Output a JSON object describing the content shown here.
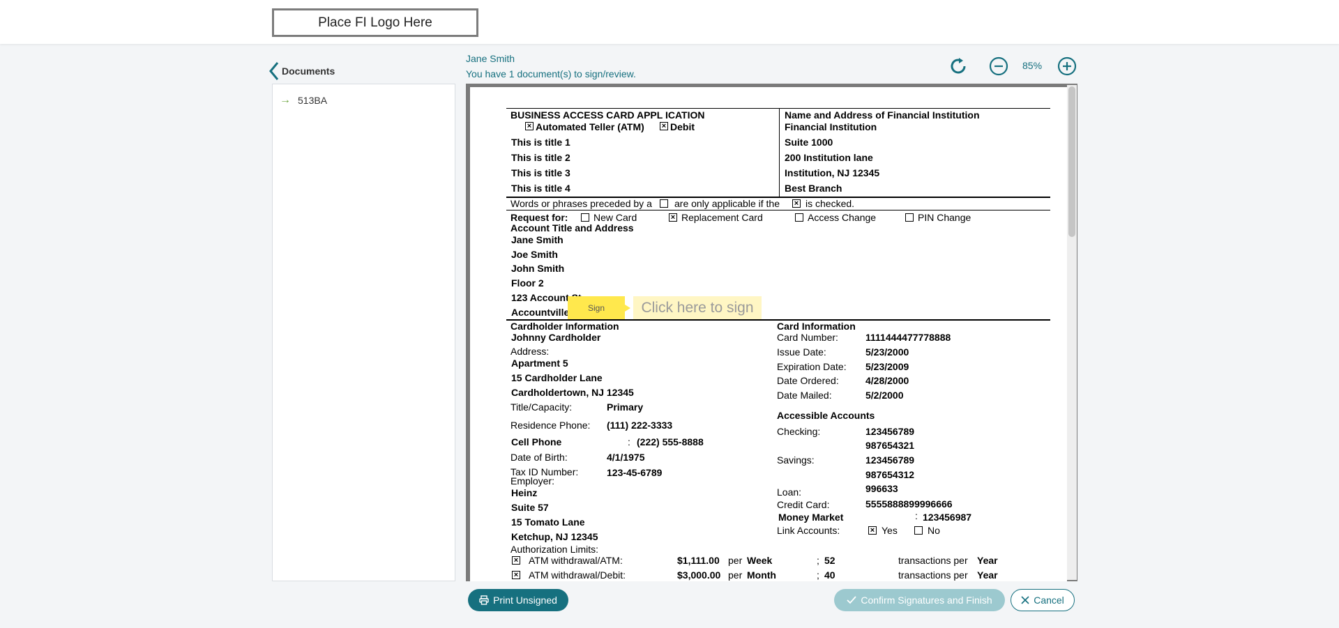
{
  "header": {
    "logo_text": "Place FI Logo Here"
  },
  "sidebar": {
    "back_label": "Documents",
    "documents": [
      {
        "label": "513BA"
      }
    ]
  },
  "viewer": {
    "user_name": "Jane Smith",
    "doc_count_text": "You have 1 document(s) to sign/review.",
    "zoom": "85%"
  },
  "document": {
    "title": "BUSINESS ACCESS CARD APPL ICATION",
    "card_types": [
      "Automated Teller (ATM)",
      "Debit"
    ],
    "titles": [
      "This is title 1",
      "This is title 2",
      "This is title 3",
      "This is title 4"
    ],
    "fi_header": "Name and Address of Financial Institution",
    "fi_lines": [
      "Financial Institution",
      "Suite 1000",
      "200 Institution lane",
      "Institution, NJ 12345",
      "Best Branch"
    ],
    "notice": {
      "p1": "Words or phrases preceded by a",
      "p2": "are only applicable if the",
      "p3": "is checked."
    },
    "request_label": "Request for:",
    "request_options": [
      "New Card",
      "Replacement Card",
      "Access Change",
      "PIN Change"
    ],
    "account_header": "Account Title and Address",
    "account_lines": [
      "Jane Smith",
      "Joe Smith",
      "John Smith",
      "Floor 2",
      "123 Account St",
      "Accountville, N"
    ],
    "sign_tab_label": "Sign",
    "sign_field_label": "Click here to sign",
    "cardholder_header": "Cardholder Information",
    "cardholder_name": "Johnny Cardholder",
    "address_label": "Address:",
    "address_lines": [
      "Apartment 5",
      "15 Cardholder Lane",
      "Cardholdertown, NJ 12345"
    ],
    "title_capacity_label": "Title/Capacity:",
    "title_capacity_value": "Primary",
    "residence_phone_label": "Residence Phone:",
    "residence_phone_value": "(111) 222-3333",
    "cell_phone_label": "Cell Phone",
    "cell_phone_value": "(222) 555-8888",
    "dob_label": "Date of Birth:",
    "dob_value": "4/1/1975",
    "taxid_label": "Tax ID Number:",
    "taxid_value": "123-45-6789",
    "employer_label": "Employer:",
    "employer_lines": [
      "Heinz",
      "Suite 57",
      "15 Tomato Lane",
      "Ketchup, NJ 12345"
    ],
    "card_info_header": "Card Information",
    "card_info": [
      {
        "label": "Card Number:",
        "value": "1111444477778888"
      },
      {
        "label": "Issue Date:",
        "value": "5/23/2000"
      },
      {
        "label": "Expiration Date:",
        "value": "5/23/2009"
      },
      {
        "label": "Date Ordered:",
        "value": "4/28/2000"
      },
      {
        "label": "Date Mailed:",
        "value": "5/2/2000"
      }
    ],
    "accounts_header": "Accessible Accounts",
    "checking_label": "Checking:",
    "checking_values": [
      "123456789",
      "987654321"
    ],
    "savings_label": "Savings:",
    "savings_values": [
      "123456789",
      "987654312"
    ],
    "loan_label": "Loan:",
    "loan_value": "996633",
    "credit_label": "Credit Card:",
    "credit_value": "5555888899996666",
    "money_market_label": "Money Market",
    "money_market_value": "123456987",
    "link_label": "Link Accounts:",
    "link_yes": "Yes",
    "link_no": "No",
    "auth_header": "Authorization Limits:",
    "auth_rows": [
      {
        "label": "ATM withdrawal/ATM:",
        "amount": "$1,111.00",
        "per": "per",
        "period": "Week",
        "count": "52",
        "tx_per": "transactions per",
        "tx_period": "Year"
      },
      {
        "label": "ATM withdrawal/Debit:",
        "amount": "$3,000.00",
        "per": "per",
        "period": "Month",
        "count": "40",
        "tx_per": "transactions per",
        "tx_period": "Year"
      }
    ]
  },
  "footer": {
    "print_label": "Print Unsigned",
    "confirm_label": "Confirm Signatures and Finish",
    "cancel_label": "Cancel"
  }
}
